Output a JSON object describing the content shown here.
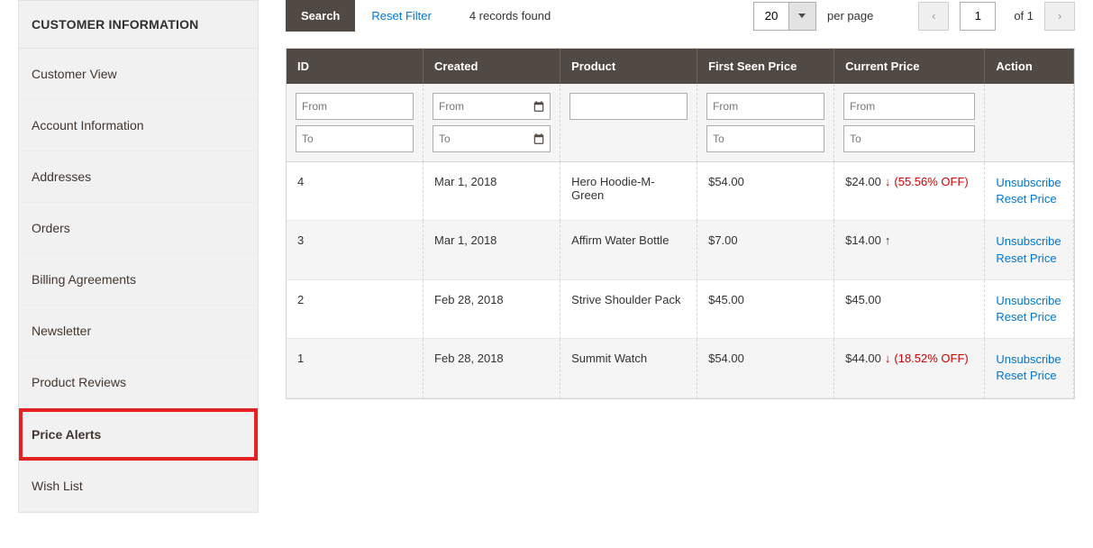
{
  "sidebar": {
    "title": "CUSTOMER INFORMATION",
    "items": [
      {
        "label": "Customer View",
        "active": false
      },
      {
        "label": "Account Information",
        "active": false
      },
      {
        "label": "Addresses",
        "active": false
      },
      {
        "label": "Orders",
        "active": false
      },
      {
        "label": "Billing Agreements",
        "active": false
      },
      {
        "label": "Newsletter",
        "active": false
      },
      {
        "label": "Product Reviews",
        "active": false
      },
      {
        "label": "Price Alerts",
        "active": true
      },
      {
        "label": "Wish List",
        "active": false
      }
    ]
  },
  "toolbar": {
    "search_label": "Search",
    "reset_filter_label": "Reset Filter",
    "records_found": "4 records found",
    "page_size": "20",
    "per_page": "per page",
    "page_current": "1",
    "page_total_label": "of 1"
  },
  "columns": {
    "id": "ID",
    "created": "Created",
    "product": "Product",
    "first_seen": "First Seen Price",
    "current": "Current Price",
    "action": "Action"
  },
  "filters": {
    "from_placeholder": "From",
    "to_placeholder": "To"
  },
  "actions": {
    "unsubscribe": "Unsubscribe",
    "reset_price": "Reset Price"
  },
  "rows": [
    {
      "id": "4",
      "created": "Mar 1, 2018",
      "product": "Hero Hoodie-M-Green",
      "first_seen": "$54.00",
      "current": "$24.00",
      "arrow": "↓",
      "discount": "(55.56% OFF)"
    },
    {
      "id": "3",
      "created": "Mar 1, 2018",
      "product": "Affirm Water Bottle",
      "first_seen": "$7.00",
      "current": "$14.00",
      "arrow": "↑",
      "discount": ""
    },
    {
      "id": "2",
      "created": "Feb 28, 2018",
      "product": "Strive Shoulder Pack",
      "first_seen": "$45.00",
      "current": "$45.00",
      "arrow": "",
      "discount": ""
    },
    {
      "id": "1",
      "created": "Feb 28, 2018",
      "product": "Summit Watch",
      "first_seen": "$54.00",
      "current": "$44.00",
      "arrow": "↓",
      "discount": "(18.52% OFF)"
    }
  ]
}
